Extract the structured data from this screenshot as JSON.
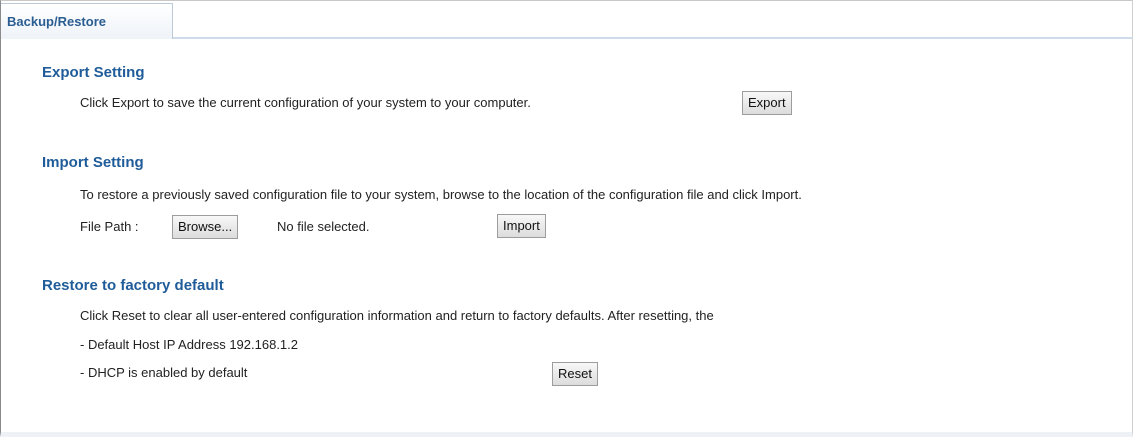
{
  "tabs": [
    {
      "label": "Backup/Restore"
    }
  ],
  "export": {
    "title": "Export Setting",
    "description": "Click Export to save the current configuration of your system to your computer.",
    "button_label": "Export"
  },
  "import": {
    "title": "Import Setting",
    "description": "To restore a previously saved configuration file to your system, browse to the location of the configuration file and click Import.",
    "file_path_label": "File Path :",
    "browse_label": "Browse...",
    "file_status": "No file selected.",
    "button_label": "Import"
  },
  "reset": {
    "title": "Restore to factory default",
    "description": "Click Reset to clear all user-entered configuration information and return to factory defaults. After resetting, the",
    "line_ip": "- Default Host IP Address 192.168.1.2",
    "line_dhcp": "- DHCP is enabled by default",
    "button_label": "Reset"
  }
}
